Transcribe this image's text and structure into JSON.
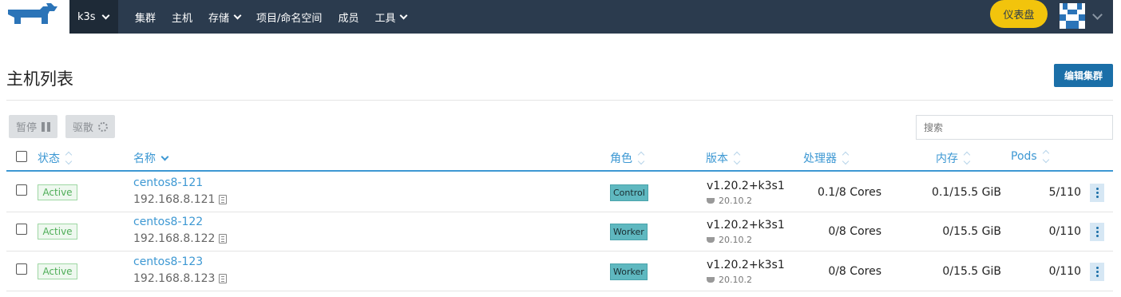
{
  "nav": {
    "cluster": "k3s",
    "items": [
      {
        "label": "集群",
        "dropdown": false
      },
      {
        "label": "主机",
        "dropdown": false
      },
      {
        "label": "存储",
        "dropdown": true
      },
      {
        "label": "项目/命名空间",
        "dropdown": false
      },
      {
        "label": "成员",
        "dropdown": false
      },
      {
        "label": "工具",
        "dropdown": true
      }
    ],
    "dashboard": "仪表盘"
  },
  "page": {
    "title": "主机列表",
    "edit_button": "编辑集群",
    "pause_button": "暂停",
    "drain_button": "驱散",
    "search_placeholder": "搜索"
  },
  "table": {
    "headers": {
      "state": "状态",
      "name": "名称",
      "role": "角色",
      "version": "版本",
      "cpu": "处理器",
      "memory": "内存",
      "pods": "Pods"
    },
    "rows": [
      {
        "state": "Active",
        "name": "centos8-121",
        "ip": "192.168.8.121",
        "role": "Control",
        "version": "v1.20.2+k3s1",
        "docker": "20.10.2",
        "cpu": "0.1/8 Cores",
        "memory": "0.1/15.5 GiB",
        "pods": "5/110"
      },
      {
        "state": "Active",
        "name": "centos8-122",
        "ip": "192.168.8.122",
        "role": "Worker",
        "version": "v1.20.2+k3s1",
        "docker": "20.10.2",
        "cpu": "0/8 Cores",
        "memory": "0/15.5 GiB",
        "pods": "0/110"
      },
      {
        "state": "Active",
        "name": "centos8-123",
        "ip": "192.168.8.123",
        "role": "Worker",
        "version": "v1.20.2+k3s1",
        "docker": "20.10.2",
        "cpu": "0/8 Cores",
        "memory": "0/15.5 GiB",
        "pods": "0/110"
      }
    ]
  },
  "colors": {
    "nav_bg": "#2b3b4e",
    "accent": "#3d98d3",
    "primary_button": "#1b6fa8",
    "dashboard_button": "#f2c40c",
    "active_green": "#4fae58",
    "role_teal": "#5fb8c0"
  }
}
